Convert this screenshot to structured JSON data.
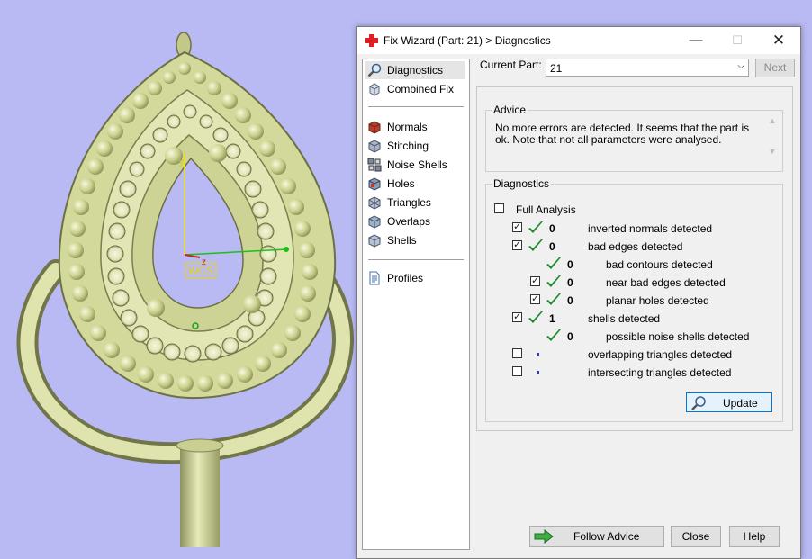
{
  "window": {
    "title": "Fix Wizard (Part: 21) > Diagnostics",
    "minimize_glyph": "—",
    "maximize_glyph": "☐",
    "close_glyph": "✕"
  },
  "viewport": {
    "axis_y_label": "y",
    "axis_z_label": "z",
    "wcs_label": "WCS"
  },
  "nav": {
    "top_items": [
      {
        "label": "Diagnostics",
        "icon": "magnifier-icon",
        "selected": true
      },
      {
        "label": "Combined Fix",
        "icon": "cube-icon"
      }
    ],
    "tool_items": [
      {
        "label": "Normals",
        "icon": "normals-icon"
      },
      {
        "label": "Stitching",
        "icon": "stitching-icon"
      },
      {
        "label": "Noise Shells",
        "icon": "noise-shells-icon"
      },
      {
        "label": "Holes",
        "icon": "holes-icon"
      },
      {
        "label": "Triangles",
        "icon": "triangles-icon"
      },
      {
        "label": "Overlaps",
        "icon": "overlaps-icon"
      },
      {
        "label": "Shells",
        "icon": "shells-icon"
      }
    ],
    "profiles": {
      "label": "Profiles",
      "icon": "document-icon"
    }
  },
  "current_part": {
    "label": "Current Part:",
    "value": "21",
    "next_label": "Next"
  },
  "advice": {
    "legend": "Advice",
    "text": "No more errors are detected. It seems that the part is ok. Note that not all parameters were analysed."
  },
  "diagnostics": {
    "legend": "Diagnostics",
    "full_analysis_label": "Full Analysis",
    "rows": [
      {
        "checked": true,
        "status": "ok",
        "count": "0",
        "label": "inverted normals detected",
        "indent": 0
      },
      {
        "checked": true,
        "status": "ok",
        "count": "0",
        "label": "bad edges detected",
        "indent": 0
      },
      {
        "checked": null,
        "status": "ok",
        "count": "0",
        "label": "bad contours detected",
        "indent": 1
      },
      {
        "checked": true,
        "status": "ok",
        "count": "0",
        "label": "near bad edges detected",
        "indent": 1
      },
      {
        "checked": true,
        "status": "ok",
        "count": "0",
        "label": "planar holes detected",
        "indent": 1
      },
      {
        "checked": true,
        "status": "ok",
        "count": "1",
        "label": "shells detected",
        "indent": 0
      },
      {
        "checked": null,
        "status": "ok",
        "count": "0",
        "label": "possible noise shells detected",
        "indent": 1
      },
      {
        "checked": false,
        "status": "not-run",
        "count": "",
        "label": "overlapping triangles detected",
        "indent": 0
      },
      {
        "checked": false,
        "status": "not-run",
        "count": "",
        "label": "intersecting triangles detected",
        "indent": 0
      }
    ],
    "update_label": "Update"
  },
  "footer": {
    "follow_advice_label": "Follow Advice",
    "close_label": "Close",
    "help_label": "Help"
  },
  "colors": {
    "background": "#b9b9f3",
    "model": "#dde2a8",
    "check_green": "#1f8a2e"
  }
}
